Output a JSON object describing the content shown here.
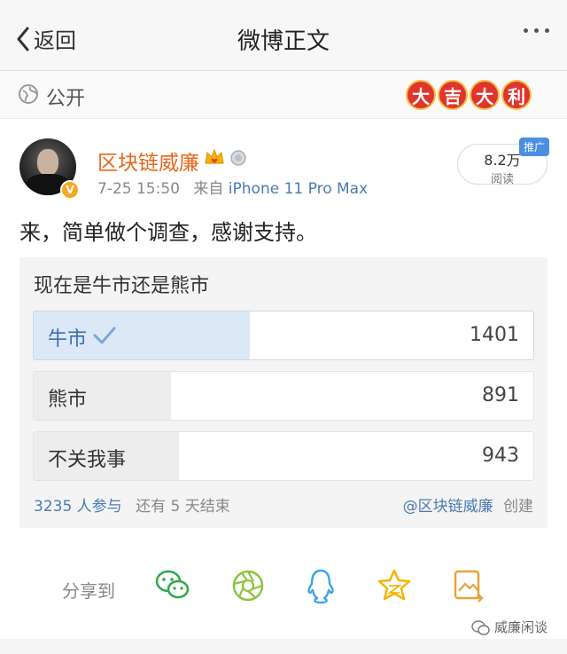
{
  "nav": {
    "back_label": "返回",
    "title": "微博正文"
  },
  "visibility": {
    "label": "公开",
    "badge_chars": [
      "大",
      "吉",
      "大",
      "利"
    ]
  },
  "post": {
    "username": "区块链威廉",
    "verified_badge": "V",
    "time": "7-25 15:50",
    "source": "来自",
    "device": "iPhone 11 Pro Max",
    "reads_count": "8.2万",
    "reads_label": "阅读",
    "promo_tag": "推广",
    "text": "来，简单做个调查，感谢支持。"
  },
  "poll": {
    "question": "现在是牛市还是熊市",
    "total": 3235,
    "options": [
      {
        "label": "牛市",
        "count": "1401",
        "fraction": 0.433,
        "selected": true
      },
      {
        "label": "熊市",
        "count": "891",
        "fraction": 0.275,
        "selected": false
      },
      {
        "label": "不关我事",
        "count": "943",
        "fraction": 0.291,
        "selected": false
      }
    ],
    "participants": "3235 人参与",
    "remaining": "还有 5 天结束",
    "creator": "@区块链威廉",
    "creator_verb": "创建"
  },
  "share": {
    "label": "分享到",
    "icons": [
      "wechat-icon",
      "moments-icon",
      "qq-icon",
      "favorite-star-icon",
      "image-share-icon"
    ]
  },
  "watermark": "威廉闲谈",
  "colors": {
    "accent_orange": "#e8671c",
    "link_blue": "#4a7bb3",
    "poll_selected": "#dce8f5"
  }
}
